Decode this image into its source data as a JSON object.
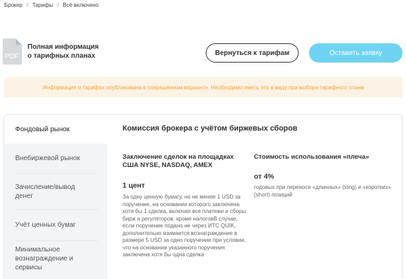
{
  "breadcrumb": {
    "items": [
      "Брокер",
      "Тарифы",
      "Всё включено"
    ],
    "separator": "/"
  },
  "pdf": {
    "icon_text": "PDF",
    "title": "Полная информация о тарифных планах"
  },
  "buttons": {
    "back_label": "Вернуться к тарифам",
    "apply_label": "Оставить заявку"
  },
  "notice": {
    "text": "Информация о тарифах опубликована в сокращённом варианте. Необходимо иметь это в виду при выборе тарифного плана"
  },
  "sidebar": {
    "items": [
      {
        "label": "Фондовый рынок",
        "active": true
      },
      {
        "label": "Внебиржевой рынок",
        "active": false
      },
      {
        "label": "Зачисление/вывод денег",
        "active": false
      },
      {
        "label": "Учёт ценных бумаг",
        "active": false
      },
      {
        "label": "Минимальное вознаграждение и сервисы",
        "active": false
      }
    ]
  },
  "content": {
    "title": "Комиссия брокера с учётом биржевых сборов",
    "left": {
      "heading": "Заключение сделок на площадках США NYSE, NASDAQ, AMEX",
      "value": "1 цент",
      "description": "За одну ценную бумагу, но не менее 1 USD за поручение, на основании которого заключена хотя бы 1 сделка, включая все платежи и сборы бирж и регуляторов, кроме налоговВ случае, если поручение подано не через ИТС QUIK, дополнительно взимается вознаграждение в размере 5 USD за одно поручение при условии, что на основании указанного поручения заключена хотя бы одна сделка"
    },
    "right": {
      "heading": "Стоимость использования «плеча»",
      "value": "от 4%",
      "description": "годовых при переносе «длинных» (long) и «коротких» (short) позиций"
    }
  },
  "colors": {
    "accent": "#6fd3f1",
    "notice_bg": "#fdf3e4",
    "notice_text": "#f0a23e",
    "sidebar_bg": "#f3f4f6"
  }
}
